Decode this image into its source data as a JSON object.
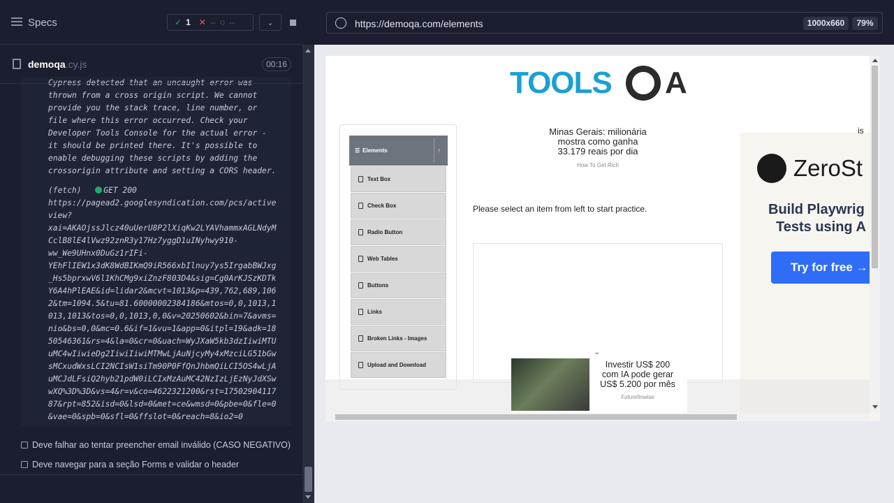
{
  "runner": {
    "specs_label": "Specs",
    "stats": {
      "passed": "1",
      "failed": "--",
      "pending": "--"
    },
    "file": {
      "name": "demoqa",
      "ext": ".cy.js",
      "duration": "00:16"
    },
    "log_lines": [
      "Cypress detected that an uncaught error was",
      "thrown from a cross origin script. We cannot",
      "provide you the stack trace, line number, or",
      "file where this error occurred. Check your",
      "Developer Tools Console for the actual error -",
      "it should be printed there. It's possible to",
      "enable debugging these scripts by adding the",
      "crossorigin attribute and setting a CORS header."
    ],
    "fetch": {
      "label": "(fetch)",
      "method_status": "GET 200"
    },
    "fetch_url_lines": [
      "https://pagead2.googlesyndication.com/pcs/active",
      "view?",
      "xai=AKAOjssJlcz40uUerU8P2lXiqKw2LYAVhammxAGLNdyM",
      "CclB8lE4lVwz92znR3y17Hz7yggD1uINyhwy910-",
      "ww_We9UHnx0DuGz1rIFi-",
      "YEhFlIEW1x3dK8WdBIKmQ9iR566xbIlnuy7ys5IrgabBWJxg",
      "_Hs5bprxwV6l1KhCMg9xiZnzF803D4&sig=Cg0ArKJSzKDTk",
      "Y6A4hPlEAE&id=lidar2&mcvt=1013&p=439,762,689,106",
      "2&tm=1094.5&tu=81.60000002384186&mtos=0,0,1013,1",
      "013,1013&tos=0,0,1013,0,0&v=20250602&bin=7&avms=",
      "nio&bs=0,0&mc=0.6&if=1&vu=1&app=0&itpl=19&adk=18",
      "50546361&rs=4&la=0&cr=0&uach=WyJXaW5kb3dzIiwiMTU",
      "uMC4wIiwieDg2IiwiIiwiMTMwLjAuNjcyMy4xMzciLG51bGw",
      "sMCxudWxsLCI2NCIsW1siTm90P0FfQnJhbmQiLCI5OS4wLjA",
      "uMCJdLFsiQ2hyb21pdW0iLCIxMzAuMC42NzIzLjEzNyJdXSw",
      "wXQ%3D%3D&vs=4&r=v&co=4622321200&rst=17502904117",
      "87&rpt=852&isd=0&lsd=0&met=ce&wmsd=0&pbe=0&fle=0",
      "&vae=0&spb=0&sfl=0&ffslot=0&reach=8&io2=0"
    ],
    "tests": [
      "Deve falhar ao tentar preencher email inválido (CASO NEGATIVO)",
      "Deve navegar para a seção Forms e validar o header"
    ]
  },
  "browser": {
    "url": "https://demoqa.com/elements",
    "viewport": "1000x660",
    "zoom": "79%"
  },
  "page": {
    "logo_text": "TOOLS",
    "logo_text2": "A",
    "sidebar_header": "Elements",
    "menu": [
      "Text Box",
      "Check Box",
      "Radio Button",
      "Web Tables",
      "Buttons",
      "Links",
      "Broken Links - Images",
      "Upload and Download"
    ],
    "promo_lines": [
      "Minas Gerais: milionária",
      "mostra como ganha",
      "33.179 reais por dia"
    ],
    "promo_source": "How To Get Rich",
    "select_text": "Please select an item from left to start practice.",
    "banner": {
      "brand": "ZeroSt",
      "line1": "Build Playwrig",
      "line2": "Tests using A",
      "cta": "Try for free →"
    },
    "partial_text": "is",
    "bottom_ad": {
      "lines": [
        "Investir US$ 200",
        "com IA pode gerar",
        "US$ 5.200 por mês"
      ],
      "source": "Futurefinwise"
    }
  },
  "colors": {
    "accent_pass": "#1fa971",
    "accent_fail": "#e45770",
    "toolsqa_blue": "#1aa0d4",
    "cta_blue": "#2f6df6"
  },
  "icons": [
    "specs-icon",
    "check-icon",
    "x-icon",
    "spinner-icon",
    "chevron-down-icon",
    "stop-icon",
    "file-icon",
    "globe-icon",
    "gear-icon",
    "elements-icon",
    "chevron-up-icon",
    "document-icon",
    "arrow-right-icon"
  ]
}
